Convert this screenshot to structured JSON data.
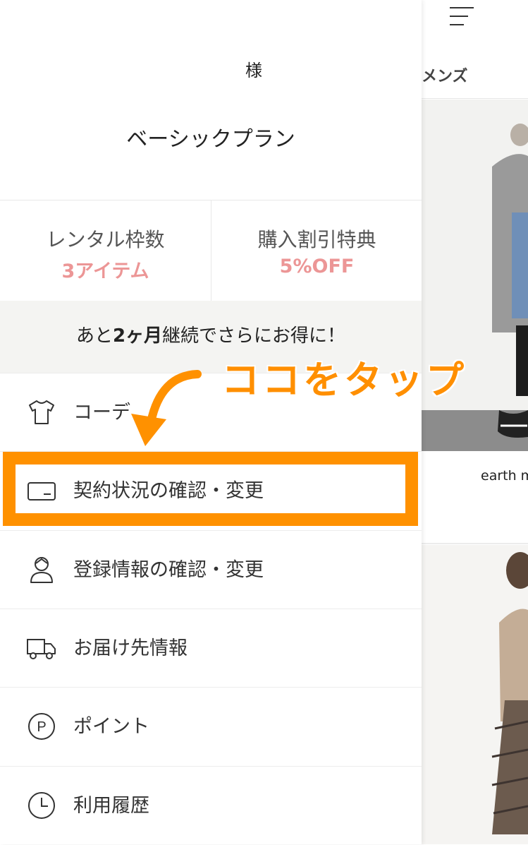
{
  "background_page": {
    "category_tab": "メンズ",
    "card_brand": "earth m"
  },
  "drawer": {
    "user_suffix": "様",
    "plan_name": "ベーシックプラン",
    "benefits": [
      {
        "label": "レンタル枠数",
        "value": "3アイテム"
      },
      {
        "label": "購入割引特典",
        "value": "5%OFF"
      }
    ],
    "promo": {
      "prefix": "あと",
      "months": "2ヶ月",
      "suffix": "継続でさらにお得に！"
    },
    "menu": [
      {
        "label": "コーデ",
        "icon": "tshirt-icon"
      },
      {
        "label": "契約状況の確認・変更",
        "icon": "credit-card-icon"
      },
      {
        "label": "登録情報の確認・変更",
        "icon": "user-icon"
      },
      {
        "label": "お届け先情報",
        "icon": "truck-icon"
      },
      {
        "label": "ポイント",
        "icon": "point-p-icon"
      },
      {
        "label": "利用履歴",
        "icon": "clock-icon"
      }
    ]
  },
  "annotation": {
    "callout": "ココをタップ",
    "color": "#ff9100"
  },
  "colors": {
    "benefit_value": "#ec9696",
    "promo_bg": "#f4f4f2"
  }
}
